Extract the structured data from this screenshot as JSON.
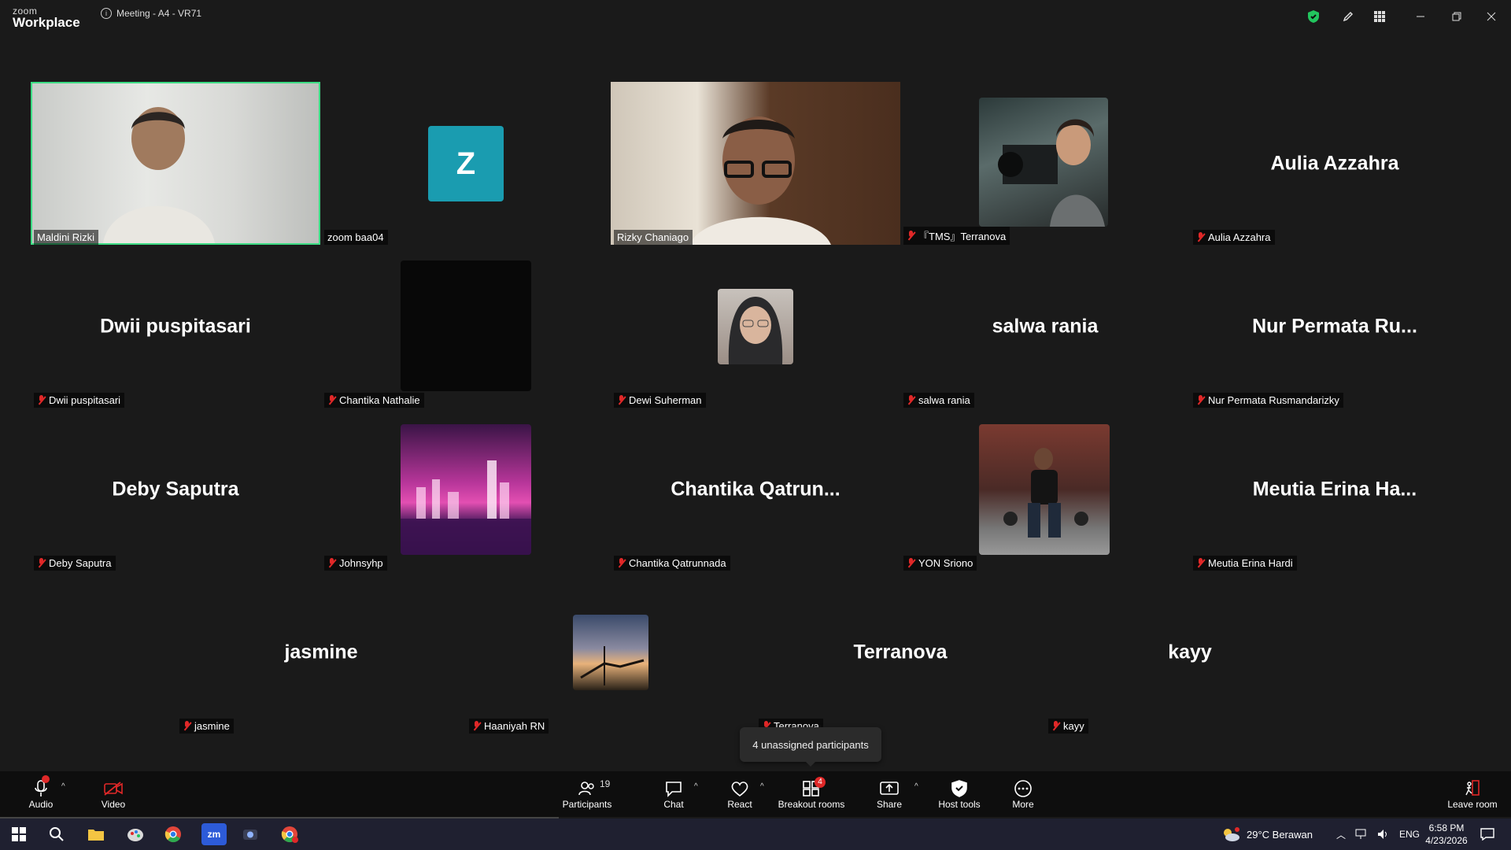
{
  "titlebar": {
    "logo_top": "zoom",
    "logo_bottom": "Workplace",
    "meeting_title": "Meeting - A4 - VR71"
  },
  "tiles": [
    {
      "label": "Maldini Rizki"
    },
    {
      "label": "zoom baa04",
      "avatar_letter": "Z"
    },
    {
      "label": "Rizky Chaniago"
    },
    {
      "label": "『TMS』Terranova"
    },
    {
      "label": "Aulia Azzahra",
      "display_name": "Aulia Azzahra"
    },
    {
      "label": "Dwii puspitasari",
      "display_name": "Dwii puspitasari"
    },
    {
      "label": "Chantika Nathalie"
    },
    {
      "label": "Dewi Suherman"
    },
    {
      "label": "salwa rania",
      "display_name": "salwa rania"
    },
    {
      "label": "Nur Permata Rusmandarizky",
      "display_name": "Nur Permata Ru..."
    },
    {
      "label": "Deby Saputra",
      "display_name": "Deby Saputra"
    },
    {
      "label": "Johnsyhp"
    },
    {
      "label": "Chantika Qatrunnada",
      "display_name": "Chantika  Qatrun..."
    },
    {
      "label": "YON Sriono"
    },
    {
      "label": "Meutia Erina Hardi",
      "display_name": "Meutia Erina Ha..."
    },
    {
      "label": "jasmine",
      "display_name": "jasmine"
    },
    {
      "label": "Haaniyah RN"
    },
    {
      "label": "Terranova",
      "display_name": "Terranova"
    },
    {
      "label": "kayy",
      "display_name": "kayy"
    }
  ],
  "tooltip": "4 unassigned participants",
  "toolbar": {
    "audio": "Audio",
    "video": "Video",
    "participants": "Participants",
    "participants_count": "19",
    "chat": "Chat",
    "react": "React",
    "breakout": "Breakout rooms",
    "breakout_badge": "4",
    "share": "Share",
    "host_tools": "Host tools",
    "more": "More",
    "leave": "Leave room"
  },
  "taskbar": {
    "weather": "29°C  Berawan",
    "lang": "ENG",
    "time": "6:58 PM",
    "date": "4/23/2026"
  },
  "colors": {
    "active_speaker": "#3ddc84",
    "mute_red": "#e02828",
    "avatar_teal": "#1a9cb0",
    "shield_green": "#22c55e"
  }
}
